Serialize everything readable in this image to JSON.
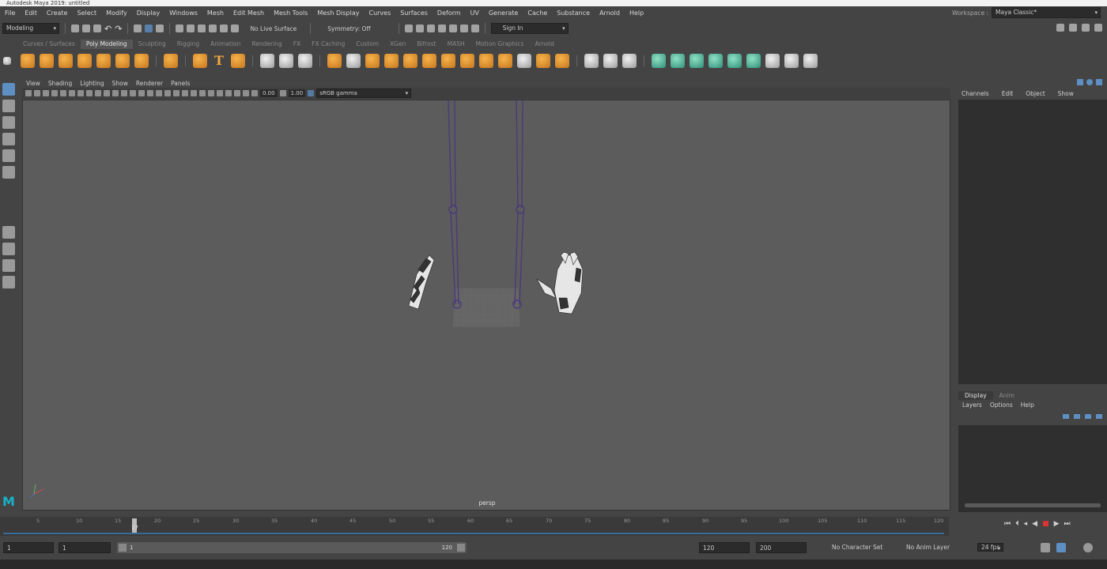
{
  "window": {
    "title": "Autodesk Maya 2019: untitled"
  },
  "menubar": [
    "File",
    "Edit",
    "Create",
    "Select",
    "Modify",
    "Display",
    "Windows",
    "Mesh",
    "Edit Mesh",
    "Mesh Tools",
    "Mesh Display",
    "Curves",
    "Surfaces",
    "Deform",
    "UV",
    "Generate",
    "Cache",
    "Substance",
    "Arnold",
    "Help"
  ],
  "workspace": {
    "label": "Workspace :",
    "value": "Maya Classic*"
  },
  "statusline": {
    "mode": "Modeling",
    "live_surface": "No Live Surface",
    "symmetry": "Symmetry: Off",
    "sign_in": "Sign In"
  },
  "shelf_tabs": [
    "Curves / Surfaces",
    "Poly Modeling",
    "Sculpting",
    "Rigging",
    "Animation",
    "Rendering",
    "FX",
    "FX Caching",
    "Custom",
    "XGen",
    "Bifrost",
    "MASH",
    "Motion Graphics",
    "Arnold"
  ],
  "shelf_text_icon": "T",
  "viewport_menu": [
    "View",
    "Shading",
    "Lighting",
    "Show",
    "Renderer",
    "Panels"
  ],
  "viewport_bar": {
    "exposure": "0.00",
    "gamma": "1.00",
    "colorspace": "sRGB gamma"
  },
  "viewport": {
    "camera_label": "persp"
  },
  "channel_box": {
    "menu": [
      "Channels",
      "Edit",
      "Object",
      "Show"
    ]
  },
  "layer_editor": {
    "tabs": [
      "Display",
      "Anim"
    ],
    "menu": [
      "Layers",
      "Options",
      "Help"
    ]
  },
  "timeslider": {
    "ticks": [
      "5",
      "10",
      "15",
      "20",
      "25",
      "30",
      "35",
      "40",
      "45",
      "50",
      "55",
      "60",
      "65",
      "70",
      "75",
      "80",
      "85",
      "90",
      "95",
      "100",
      "105",
      "110",
      "115",
      "120"
    ],
    "current_frame": "17"
  },
  "range": {
    "start": "1",
    "playback_start": "1",
    "range_start_label": "1",
    "range_end_label": "120",
    "playback_end": "120",
    "end": "200",
    "character_set": "No Character Set",
    "anim_layer": "No Anim Layer",
    "fps": "24 fps"
  },
  "colors": {
    "accent": "#5e8fc3",
    "shelf_orange": "#e8992f",
    "rig_line": "#4b3a7a"
  }
}
